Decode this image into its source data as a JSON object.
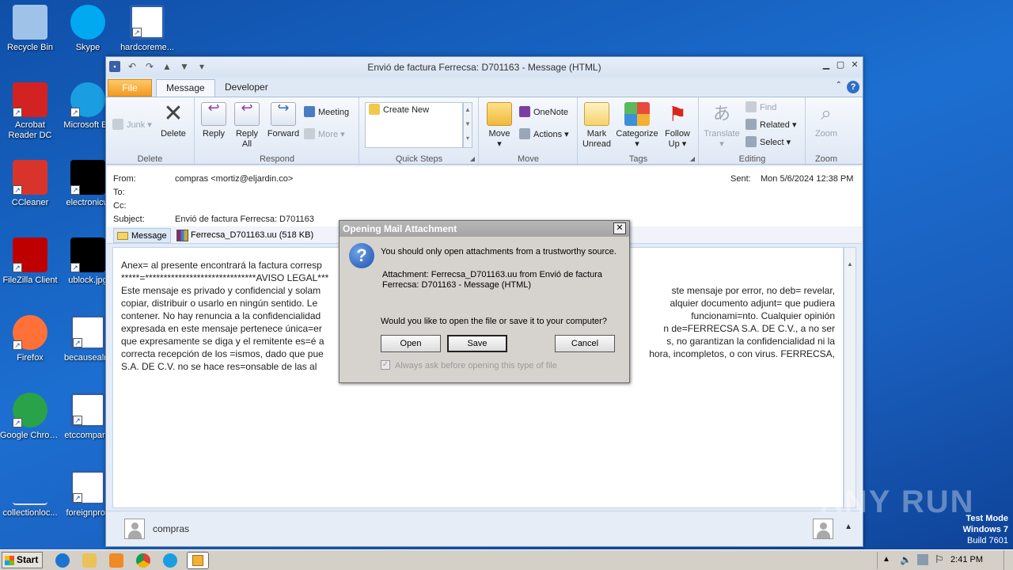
{
  "desktop": {
    "icons": [
      {
        "label": "Recycle Bin",
        "icon": "recycle-bin-icon",
        "color": "#9fc3e8"
      },
      {
        "label": "Skype",
        "icon": "skype-icon",
        "color": "#00a9f0"
      },
      {
        "label": "hardcoreme...",
        "icon": "word-document-icon",
        "color": "#2b5fb4"
      },
      {
        "label": "Acrobat Reader DC",
        "icon": "acrobat-icon",
        "color": "#d32222"
      },
      {
        "label": "Microsoft Ed",
        "icon": "edge-icon",
        "color": "#1b9de2"
      },
      {
        "label": "CCleaner",
        "icon": "ccleaner-icon",
        "color": "#d9342b"
      },
      {
        "label": "electronicw",
        "icon": "black-file-icon",
        "color": "#000000"
      },
      {
        "label": "FileZilla Client",
        "icon": "filezilla-icon",
        "color": "#bf0000"
      },
      {
        "label": "ublock.jpg",
        "icon": "black-file-icon",
        "color": "#000000"
      },
      {
        "label": "Firefox",
        "icon": "firefox-icon",
        "color": "#ff7139"
      },
      {
        "label": "becausealre",
        "icon": "word-document-icon",
        "color": "#2b5fb4"
      },
      {
        "label": "Google Chrome",
        "icon": "chrome-icon",
        "color": "#2aa24a"
      },
      {
        "label": "etccompany",
        "icon": "word-document-icon",
        "color": "#2b5fb4"
      },
      {
        "label": "collectionloc...",
        "icon": "blank-file-icon",
        "color": "#1c5fbf"
      },
      {
        "label": "foreignprov",
        "icon": "word-document-icon",
        "color": "#2b5fb4"
      }
    ]
  },
  "window": {
    "title": "Envió de factura Ferrecsa: D701163 - Message (HTML)",
    "tabs": {
      "file": "File",
      "message": "Message",
      "developer": "Developer"
    }
  },
  "ribbon": {
    "delete_group": {
      "label": "Delete",
      "junk": "Junk",
      "delete": "Delete"
    },
    "respond_group": {
      "label": "Respond",
      "reply": "Reply",
      "reply_all": "Reply All",
      "forward": "Forward",
      "meeting": "Meeting",
      "more": "More"
    },
    "quicksteps_group": {
      "label": "Quick Steps",
      "create_new": "Create New"
    },
    "move_group": {
      "label": "Move",
      "move": "Move",
      "onenote": "OneNote",
      "actions": "Actions"
    },
    "tags_group": {
      "label": "Tags",
      "mark_unread": "Mark Unread",
      "categorize": "Categorize",
      "follow_up": "Follow Up"
    },
    "editing_group": {
      "label": "Editing",
      "translate": "Translate",
      "find": "Find",
      "related": "Related",
      "select": "Select"
    },
    "zoom_group": {
      "label": "Zoom",
      "zoom": "Zoom"
    }
  },
  "header": {
    "from_label": "From:",
    "from_value": "compras <mortiz@eljardin.co>",
    "to_label": "To:",
    "cc_label": "Cc:",
    "subject_label": "Subject:",
    "subject_value": "Envió de factura Ferrecsa: D701163",
    "sent_label": "Sent:",
    "sent_value": "Mon 5/6/2024 12:38 PM"
  },
  "attachments": {
    "message_tab": "Message",
    "file": "Ferrecsa_D701163.uu (518 KB)"
  },
  "body": {
    "line1": "Anex= al presente encontrará la factura corresp",
    "line2": "*****=******************************AVISO LEGAL***",
    "line3_left": "Este mensaje es privado y confidencial y solam",
    "line3_right": "ste mensaje por error, no deb= revelar,",
    "line4_left": "copiar, distribuir o usarlo en ningún sentido. Le",
    "line4_right": "alquier documento adjunt= que pudiera",
    "line5_left": "contener. No hay renuncia a la confidencialidad",
    "line5_right": "funcionami=nto. Cualquier opinión",
    "line6_left": "expresada en este mensaje pertenece única=er",
    "line6_right": "n de=FERRECSA S.A. DE C.V., a no ser",
    "line7_left": "que expresamente se diga y el remitente es=é a",
    "line7_right": "s, no garantizan la confidencialidad ni la",
    "line8_left": "correcta recepción de los =ismos, dado que pue",
    "line8_right": "hora, incompletos, o con virus. FERRECSA,",
    "line9": "S.A. DE C.V. no se hace res=onsable de las al"
  },
  "people_pane": {
    "name": "compras"
  },
  "dialog": {
    "title": "Opening Mail Attachment",
    "warning": "You should only open attachments from a trustworthy source.",
    "attachment_line1": "Attachment: Ferrecsa_D701163.uu from Envió de factura",
    "attachment_line2": "Ferrecsa: D701163 - Message (HTML)",
    "question": "Would you like to open the file or save it to your computer?",
    "open": "Open",
    "save": "Save",
    "cancel": "Cancel",
    "checkbox": "Always ask before opening this type of file",
    "checkbox_checked": true
  },
  "taskbar": {
    "start": "Start",
    "clock": "2:41 PM"
  },
  "watermark": {
    "line1": "Test Mode",
    "line2": "Windows 7",
    "line3": "Build 7601",
    "brand": "ANY RUN"
  }
}
